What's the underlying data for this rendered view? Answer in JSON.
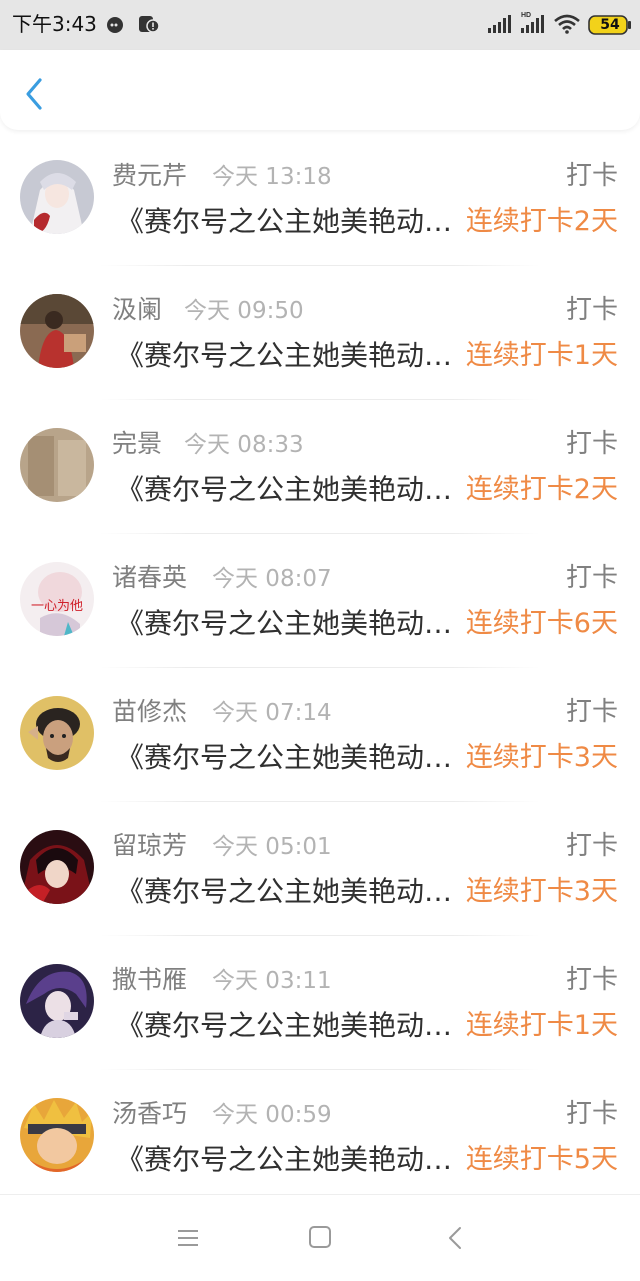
{
  "status_bar": {
    "time": "下午3:43",
    "battery": "54"
  },
  "header": {
    "back_icon": "chevron-left-icon",
    "accent_color": "#3a9de0"
  },
  "colors": {
    "streak": "#ef8a45",
    "name": "#808080",
    "time": "#b3b3b3",
    "title": "#303030"
  },
  "entries": [
    {
      "name": "费元芹",
      "time": "今天 13:18",
      "tag": "打卡",
      "title": "《赛尔号之公主她美艳动人》",
      "streak": "连续打卡2天"
    },
    {
      "name": "汲阑",
      "time": "今天 09:50",
      "tag": "打卡",
      "title": "《赛尔号之公主她美艳动人》",
      "streak": "连续打卡1天"
    },
    {
      "name": "完景",
      "time": "今天 08:33",
      "tag": "打卡",
      "title": "《赛尔号之公主她美艳动人》",
      "streak": "连续打卡2天"
    },
    {
      "name": "诸春英",
      "time": "今天 08:07",
      "tag": "打卡",
      "title": "《赛尔号之公主她美艳动人》",
      "streak": "连续打卡6天",
      "avatar_text": "一心为他"
    },
    {
      "name": "苗修杰",
      "time": "今天 07:14",
      "tag": "打卡",
      "title": "《赛尔号之公主她美艳动人》",
      "streak": "连续打卡3天"
    },
    {
      "name": "留琼芳",
      "time": "今天 05:01",
      "tag": "打卡",
      "title": "《赛尔号之公主她美艳动人》",
      "streak": "连续打卡3天"
    },
    {
      "name": "撒书雁",
      "time": "今天 03:11",
      "tag": "打卡",
      "title": "《赛尔号之公主她美艳动人》",
      "streak": "连续打卡1天"
    },
    {
      "name": "汤香巧",
      "time": "今天 00:59",
      "tag": "打卡",
      "title": "《赛尔号之公主她美艳动人》",
      "streak": "连续打卡5天"
    }
  ],
  "nav": {
    "menu_icon": "menu-icon",
    "home_icon": "home-square-icon",
    "back_icon": "back-triangle-icon"
  }
}
